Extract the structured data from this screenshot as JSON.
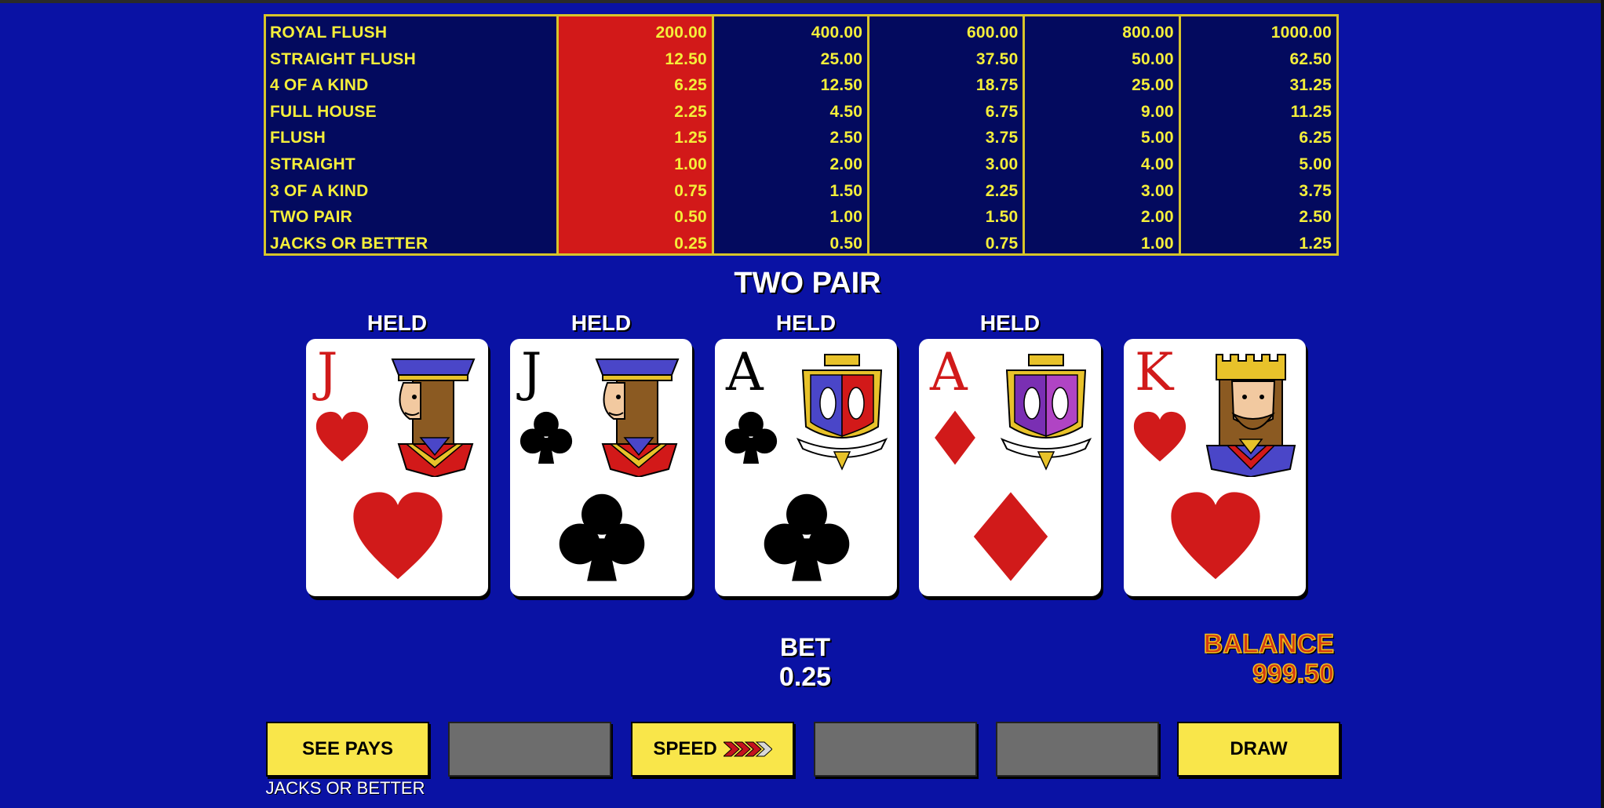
{
  "paytable": {
    "hands": [
      "ROYAL FLUSH",
      "STRAIGHT FLUSH",
      "4 OF A KIND",
      "FULL HOUSE",
      "FLUSH",
      "STRAIGHT",
      "3 OF A KIND",
      "TWO PAIR",
      "JACKS OR BETTER"
    ],
    "active_column": 0,
    "columns": [
      [
        "200.00",
        "12.50",
        "6.25",
        "2.25",
        "1.25",
        "1.00",
        "0.75",
        "0.50",
        "0.25"
      ],
      [
        "400.00",
        "25.00",
        "12.50",
        "4.50",
        "2.50",
        "2.00",
        "1.50",
        "1.00",
        "0.50"
      ],
      [
        "600.00",
        "37.50",
        "18.75",
        "6.75",
        "3.75",
        "3.00",
        "2.25",
        "1.50",
        "0.75"
      ],
      [
        "800.00",
        "50.00",
        "25.00",
        "9.00",
        "5.00",
        "4.00",
        "3.00",
        "2.00",
        "1.00"
      ],
      [
        "1000.00",
        "62.50",
        "31.25",
        "11.25",
        "6.25",
        "5.00",
        "3.75",
        "2.50",
        "1.25"
      ]
    ]
  },
  "result": "TWO PAIR",
  "cards": [
    {
      "held_label": "HELD",
      "rank": "J",
      "suit": "hearts",
      "color": "red",
      "face": "jack"
    },
    {
      "held_label": "HELD",
      "rank": "J",
      "suit": "clubs",
      "color": "black",
      "face": "jack"
    },
    {
      "held_label": "HELD",
      "rank": "A",
      "suit": "clubs",
      "color": "black",
      "face": "ace-crest"
    },
    {
      "held_label": "HELD",
      "rank": "A",
      "suit": "diamonds",
      "color": "red",
      "face": "ace-crest"
    },
    {
      "held_label": "",
      "rank": "K",
      "suit": "hearts",
      "color": "red",
      "face": "king"
    }
  ],
  "bet": {
    "label": "BET",
    "value": "0.25"
  },
  "balance": {
    "label": "BALANCE",
    "value": "999.50"
  },
  "buttons": {
    "see_pays": "SEE PAYS",
    "speed": "SPEED",
    "draw": "DRAW",
    "game_name": "JACKS OR BETTER"
  },
  "colors": {
    "background": "#0a12a4",
    "paytable_bg": "#030a5e",
    "active_column": "#d21919",
    "text_yellow": "#f4ee3a",
    "button_yellow": "#f9e64a",
    "button_gray": "#6d6d6d"
  }
}
